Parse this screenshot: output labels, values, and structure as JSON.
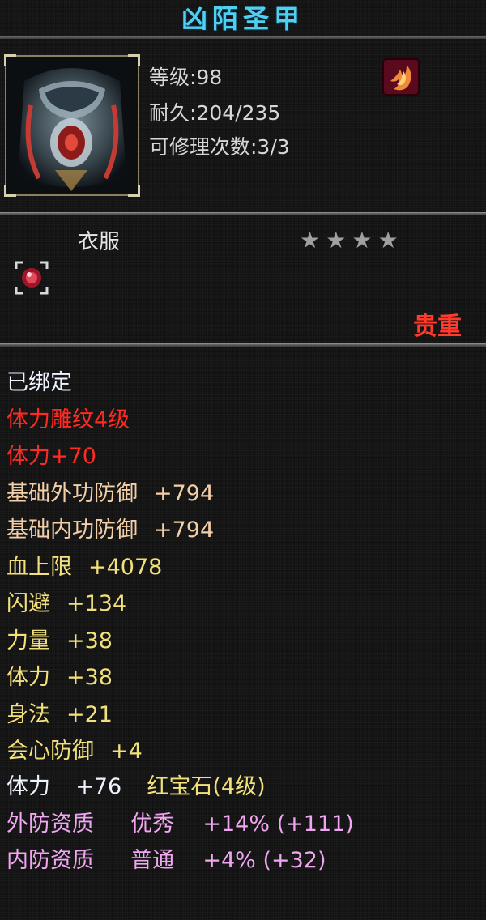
{
  "item": {
    "name": "凶陌圣甲",
    "level_text": "等级:98",
    "durability_text": "耐久:204/235",
    "repair_text": "可修理次数:3/3",
    "slot_type": "衣服",
    "stars": 4,
    "rarity": "贵重"
  },
  "attributes": [
    {
      "key": "bound",
      "label": "已绑定",
      "value": "",
      "color": "#eef3ff"
    },
    {
      "key": "engrave",
      "label": "体力雕纹4级",
      "value": "",
      "color": "#ff2a22"
    },
    {
      "key": "engrave-bonus",
      "label": "体力+70",
      "value": "",
      "color": "#ff2a22"
    },
    {
      "key": "base-ext-def",
      "label": "基础外功防御",
      "value": "+794",
      "color": "#f3cfa8"
    },
    {
      "key": "base-int-def",
      "label": "基础内功防御",
      "value": "+794",
      "color": "#f3cfa8"
    },
    {
      "key": "hp-max",
      "label": "血上限",
      "value": "+4078",
      "color": "#f2e17a"
    },
    {
      "key": "dodge",
      "label": "闪避",
      "value": "+134",
      "color": "#f2e17a"
    },
    {
      "key": "strength",
      "label": "力量",
      "value": "+38",
      "color": "#f2e17a"
    },
    {
      "key": "stamina",
      "label": "体力",
      "value": "+38",
      "color": "#f2e17a"
    },
    {
      "key": "agility",
      "label": "身法",
      "value": "+21",
      "color": "#f2e17a"
    },
    {
      "key": "crit-def",
      "label": "会心防御",
      "value": "+4",
      "color": "#f2e17a"
    }
  ],
  "gem_line": {
    "label": "体力",
    "value": "+76",
    "gem": "红宝石(4级)"
  },
  "quality": [
    {
      "label": "外防资质",
      "grade": "优秀",
      "value": "+14%",
      "extra": "(+111)"
    },
    {
      "label": "内防资质",
      "grade": "普通",
      "value": "+4%",
      "extra": "(+32)"
    }
  ],
  "colors": {
    "title": "#4fd0f0",
    "rarity": "#ff3b2d",
    "star": "#a0a0a0",
    "frame": "#8b8060"
  }
}
